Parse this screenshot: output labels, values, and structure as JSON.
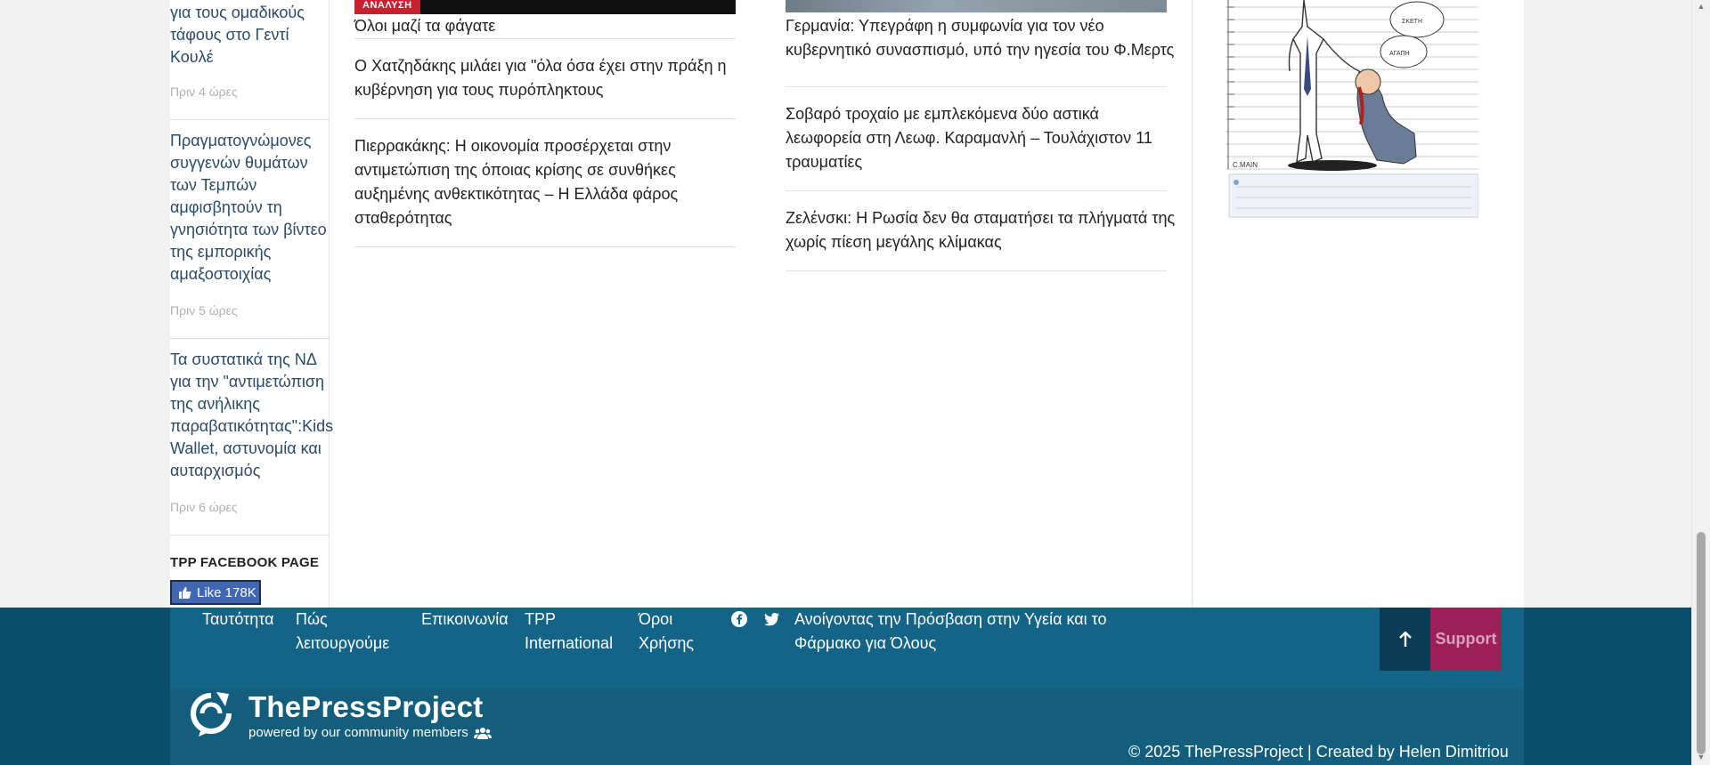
{
  "sidebar": {
    "items": [
      {
        "title": "για τους ομαδικούς τάφους στο Γεντί Κουλέ",
        "time": "Πριν 4 ώρες"
      },
      {
        "title": "Πραγματογνώμονες συγγενών θυμάτων των Τεμπών αμφισβητούν τη γνησιότητα των βίντεο της εμπορικής αμαξοστοιχίας",
        "time": "Πριν 5 ώρες"
      },
      {
        "title": "Τα συστατικά της ΝΔ για την \"αντιμετώπιση της ανήλικης παραβατικότητας\":Kids Wallet, αστυνομία και αυταρχισμός",
        "time": "Πριν 6 ώρες"
      }
    ],
    "facebook_title": "TPP FACEBOOK PAGE",
    "facebook_like": "Like 178K"
  },
  "main": {
    "left_tag": "ΑΝΑΛΥΣΗ",
    "left_column": [
      "Όλοι μαζί τα φάγατε",
      "Ο Χατζηδάκης μιλάει για \"όλα όσα έχει στην πράξη η κυβέρνηση για τους πυρόπληκτους",
      "Πιερρακάκης: Η οικονομία προσέρχεται στην αντιμετώπιση της όποιας κρίσης σε συνθήκες αυξημένης ανθεκτικότητας – Η Ελλάδα φάρος σταθερότητας"
    ],
    "right_column": [
      "Γερμανία: Υπεγράφη η συμφωνία για τον νέο κυβερνητικό συνασπισμό, υπό την ηγεσία του Φ.Μερτς",
      "Σοβαρό τροχαίο με εμπλεκόμενα δύο αστικά λεωφορεία στη Λεωφ. Καραμανλή – Τουλάχιστον 11 τραυματίες",
      "Ζελένσκι: Η Ρωσία δεν θα σταματήσει τα πλήγματά της χωρίς πίεση μεγάλης κλίμακας"
    ]
  },
  "footer": {
    "links": [
      "Ταυτότητα",
      "Πώς λειτουργούμε",
      "Επικοινωνία",
      "TPP International",
      "Όροι Χρήσης"
    ],
    "campaign_link": "Ανοίγοντας την Πρόσβαση στην Υγεία και το Φάρμακο για Όλους",
    "support_label": "Support",
    "brand": "ThePressProject",
    "brand_tagline": "powered by our community members",
    "copyright": "© 2025 ThePressProject | Created by Helen Dimitriou",
    "icons": [
      "facebook-icon",
      "twitter-icon",
      "arrow-up-icon",
      "group-icon"
    ]
  },
  "colors": {
    "footer": "#146487",
    "footer_dark": "#0c4d6b",
    "support": "#9c1f57",
    "tag": "#c8202f",
    "facebook": "#4267b2"
  }
}
